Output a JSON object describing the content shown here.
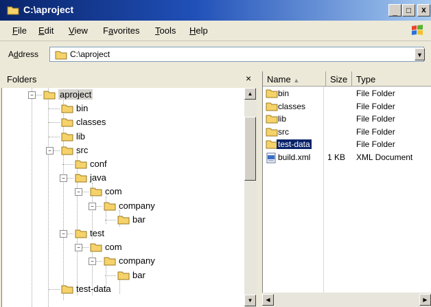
{
  "window": {
    "title": "C:\\aproject"
  },
  "menu": [
    {
      "label": "File",
      "key": "F",
      "rest": "ile"
    },
    {
      "label": "Edit",
      "key": "E",
      "rest": "dit"
    },
    {
      "label": "View",
      "key": "V",
      "rest": "iew"
    },
    {
      "label": "Favorites",
      "key": "a",
      "pre": "F",
      "rest": "vorites"
    },
    {
      "label": "Tools",
      "key": "T",
      "rest": "ools"
    },
    {
      "label": "Help",
      "key": "H",
      "rest": "elp"
    }
  ],
  "address": {
    "label": "Address",
    "value": "C:\\aproject"
  },
  "folders_pane": {
    "title": "Folders",
    "close_glyph": "×"
  },
  "tree": [
    {
      "label": "aproject",
      "depth": 0,
      "expander": "−",
      "selected": true
    },
    {
      "label": "bin",
      "depth": 1
    },
    {
      "label": "classes",
      "depth": 1
    },
    {
      "label": "lib",
      "depth": 1
    },
    {
      "label": "src",
      "depth": 1,
      "expander": "−"
    },
    {
      "label": "conf",
      "depth": 2
    },
    {
      "label": "java",
      "depth": 2,
      "expander": "−"
    },
    {
      "label": "com",
      "depth": 3,
      "expander": "−"
    },
    {
      "label": "company",
      "depth": 4,
      "expander": "−"
    },
    {
      "label": "bar",
      "depth": 5
    },
    {
      "label": "test",
      "depth": 2,
      "expander": "−"
    },
    {
      "label": "com",
      "depth": 3,
      "expander": "−"
    },
    {
      "label": "company",
      "depth": 4,
      "expander": "−"
    },
    {
      "label": "bar",
      "depth": 5
    },
    {
      "label": "test-data",
      "depth": 1
    }
  ],
  "files": {
    "columns": [
      {
        "label": "Name",
        "sort": "▲"
      },
      {
        "label": "Size"
      },
      {
        "label": "Type"
      }
    ],
    "rows": [
      {
        "name": "bin",
        "size": "",
        "type": "File Folder",
        "icon": "folder"
      },
      {
        "name": "classes",
        "size": "",
        "type": "File Folder",
        "icon": "folder"
      },
      {
        "name": "lib",
        "size": "",
        "type": "File Folder",
        "icon": "folder"
      },
      {
        "name": "src",
        "size": "",
        "type": "File Folder",
        "icon": "folder"
      },
      {
        "name": "test-data",
        "size": "",
        "type": "File Folder",
        "icon": "folder",
        "selected": true
      },
      {
        "name": "build.xml",
        "size": "1 KB",
        "type": "XML Document",
        "icon": "xml"
      }
    ]
  },
  "colors": {
    "selection": "#0a246a",
    "title_start": "#0a246a",
    "folder": "#f5d26a"
  }
}
